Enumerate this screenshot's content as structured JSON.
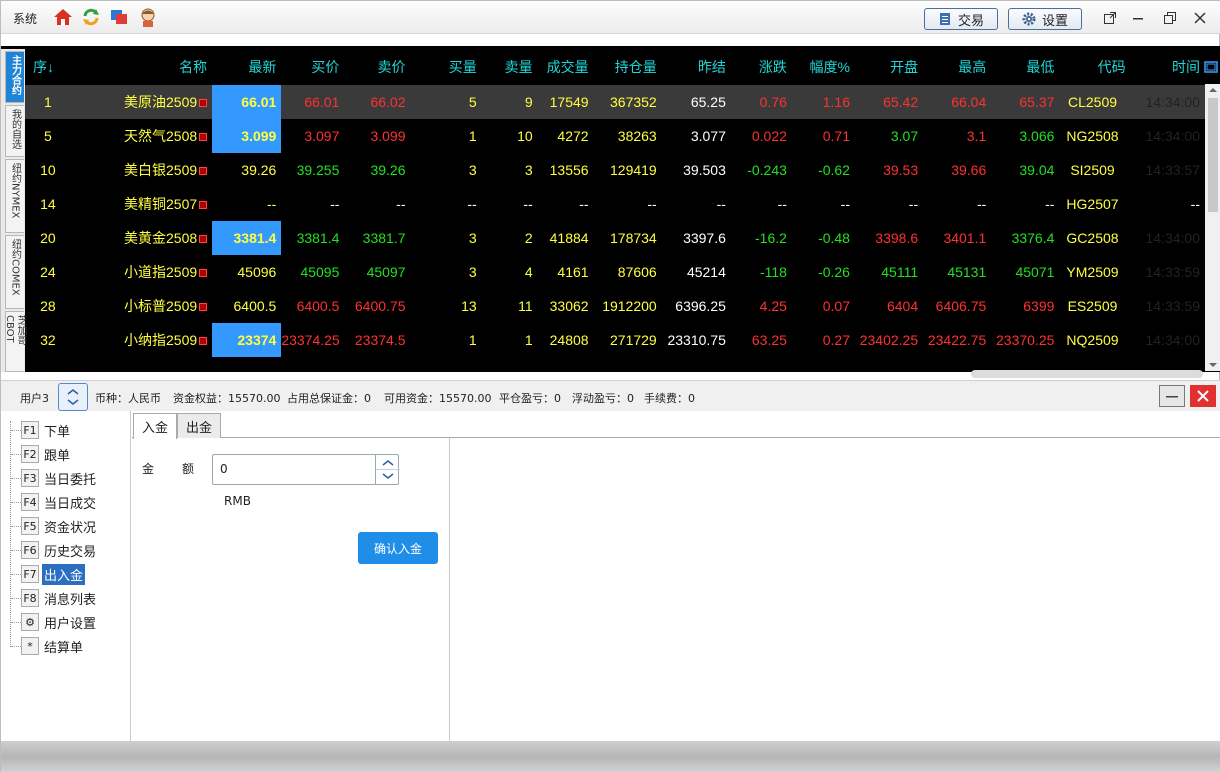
{
  "titlebar": {
    "system_menu": "系统",
    "trade_button": "交易",
    "settings_button": "设置",
    "icons": [
      "home-icon",
      "refresh-icon",
      "windows-icon",
      "avatar-icon"
    ]
  },
  "side_tabs": [
    "主力合约",
    "我的自选",
    "纽约NYMEX",
    "纽约COMEX",
    "芝加哥CBOT"
  ],
  "quote_table": {
    "headers": [
      "序↓",
      "名称",
      "最新",
      "买价",
      "卖价",
      "买量",
      "卖量",
      "成交量",
      "持仓量",
      "昨结",
      "涨跌",
      "幅度%",
      "开盘",
      "最高",
      "最低",
      "代码",
      "时间"
    ],
    "rows": [
      {
        "seq": "1",
        "name": "美原油2509",
        "last": "66.01",
        "bid": "66.01",
        "ask": "66.02",
        "bid_vol": "5",
        "ask_vol": "9",
        "volume": "17549",
        "oi": "367352",
        "prev": "65.25",
        "chg": "0.76",
        "pct": "1.16",
        "open": "65.42",
        "high": "66.04",
        "low": "65.37",
        "code": "CL2509",
        "time": "14:34:00"
      },
      {
        "seq": "5",
        "name": "天然气2508",
        "last": "3.099",
        "bid": "3.097",
        "ask": "3.099",
        "bid_vol": "1",
        "ask_vol": "10",
        "volume": "4272",
        "oi": "38263",
        "prev": "3.077",
        "chg": "0.022",
        "pct": "0.71",
        "open": "3.07",
        "high": "3.1",
        "low": "3.066",
        "code": "NG2508",
        "time": "14:34:00"
      },
      {
        "seq": "10",
        "name": "美白银2509",
        "last": "39.26",
        "bid": "39.255",
        "ask": "39.26",
        "bid_vol": "3",
        "ask_vol": "3",
        "volume": "13556",
        "oi": "129419",
        "prev": "39.503",
        "chg": "-0.243",
        "pct": "-0.62",
        "open": "39.53",
        "high": "39.66",
        "low": "39.04",
        "code": "SI2509",
        "time": "14:33:57"
      },
      {
        "seq": "14",
        "name": "美精铜2507",
        "last": "--",
        "bid": "--",
        "ask": "--",
        "bid_vol": "--",
        "ask_vol": "--",
        "volume": "--",
        "oi": "--",
        "prev": "--",
        "chg": "--",
        "pct": "--",
        "open": "--",
        "high": "--",
        "low": "--",
        "code": "HG2507",
        "time": "--"
      },
      {
        "seq": "20",
        "name": "美黄金2508",
        "last": "3381.4",
        "bid": "3381.4",
        "ask": "3381.7",
        "bid_vol": "3",
        "ask_vol": "2",
        "volume": "41884",
        "oi": "178734",
        "prev": "3397.6",
        "chg": "-16.2",
        "pct": "-0.48",
        "open": "3398.6",
        "high": "3401.1",
        "low": "3376.4",
        "code": "GC2508",
        "time": "14:34:00"
      },
      {
        "seq": "24",
        "name": "小道指2509",
        "last": "45096",
        "bid": "45095",
        "ask": "45097",
        "bid_vol": "3",
        "ask_vol": "4",
        "volume": "4161",
        "oi": "87606",
        "prev": "45214",
        "chg": "-118",
        "pct": "-0.26",
        "open": "45111",
        "high": "45131",
        "low": "45071",
        "code": "YM2509",
        "time": "14:33:59"
      },
      {
        "seq": "28",
        "name": "小标普2509",
        "last": "6400.5",
        "bid": "6400.5",
        "ask": "6400.75",
        "bid_vol": "13",
        "ask_vol": "11",
        "volume": "33062",
        "oi": "1912200",
        "prev": "6396.25",
        "chg": "4.25",
        "pct": "0.07",
        "open": "6404",
        "high": "6406.75",
        "low": "6399",
        "code": "ES2509",
        "time": "14:33:59"
      },
      {
        "seq": "32",
        "name": "小纳指2509",
        "last": "23374",
        "bid": "23374.25",
        "ask": "23374.5",
        "bid_vol": "1",
        "ask_vol": "1",
        "volume": "24808",
        "oi": "271729",
        "prev": "23310.75",
        "chg": "63.25",
        "pct": "0.27",
        "open": "23402.25",
        "high": "23422.75",
        "low": "23370.25",
        "code": "NQ2509",
        "time": "14:34:00"
      }
    ],
    "row_colors": [
      {
        "last": "yellow",
        "bid": "red",
        "ask": "red",
        "hl": true,
        "chg": "red",
        "open": "red",
        "high": "red",
        "low": "red"
      },
      {
        "last": "yellow",
        "bid": "red",
        "ask": "red",
        "hl": true,
        "chg": "red",
        "open": "green",
        "high": "red",
        "low": "green"
      },
      {
        "last": "green",
        "bid": "green",
        "ask": "green",
        "hl": false,
        "chg": "green",
        "open": "red",
        "high": "red",
        "low": "green"
      },
      {
        "last": "white",
        "bid": "white",
        "ask": "white",
        "hl": false,
        "chg": "white",
        "open": "white",
        "high": "white",
        "low": "white"
      },
      {
        "last": "yellow",
        "bid": "green",
        "ask": "green",
        "hl": true,
        "chg": "green",
        "open": "red",
        "high": "red",
        "low": "green"
      },
      {
        "last": "green",
        "bid": "green",
        "ask": "green",
        "hl": false,
        "chg": "green",
        "open": "green",
        "high": "green",
        "low": "green"
      },
      {
        "last": "red",
        "bid": "red",
        "ask": "red",
        "hl": false,
        "chg": "red",
        "open": "red",
        "high": "red",
        "low": "red"
      },
      {
        "last": "yellow",
        "bid": "red",
        "ask": "red",
        "hl": true,
        "chg": "red",
        "open": "red",
        "high": "red",
        "low": "red"
      }
    ]
  },
  "account_bar": {
    "user": "用户3",
    "currency": "币种：人民币",
    "equity": "资金权益：15570.00",
    "margin": "占用总保证金：0",
    "available": "可用资金：15570.00",
    "closed_pnl": "平仓盈亏：0",
    "float_pnl": "浮动盈亏：0",
    "fee": "手续费：0"
  },
  "nav": [
    {
      "key": "F1",
      "label": "下单"
    },
    {
      "key": "F2",
      "label": "跟单"
    },
    {
      "key": "F3",
      "label": "当日委托"
    },
    {
      "key": "F4",
      "label": "当日成交"
    },
    {
      "key": "F5",
      "label": "资金状况"
    },
    {
      "key": "F6",
      "label": "历史交易"
    },
    {
      "key": "F7",
      "label": "出入金"
    },
    {
      "key": "F8",
      "label": "消息列表"
    },
    {
      "key": "⚙",
      "label": "用户设置"
    },
    {
      "key": "*",
      "label": "结算单"
    }
  ],
  "tabs": [
    "入金",
    "出金"
  ],
  "deposit_form": {
    "amount_label": "金额",
    "amount_value": "0",
    "unit": "RMB",
    "confirm_button": "确认入金"
  }
}
